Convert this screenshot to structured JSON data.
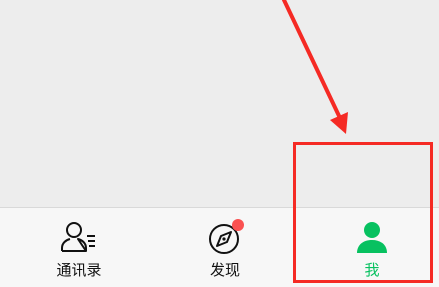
{
  "tabbar": {
    "tabs": [
      {
        "label": "通讯录",
        "icon": "contacts-icon",
        "active": false
      },
      {
        "label": "发现",
        "icon": "discover-compass-icon",
        "active": false,
        "badge": "red-dot"
      },
      {
        "label": "我",
        "icon": "me-person-icon",
        "active": true
      }
    ]
  },
  "colors": {
    "active": "#07c160",
    "inactive_text": "#111111",
    "annotation": "#f52a24",
    "badge": "#fa5151",
    "background": "#ededed",
    "tabbar_background": "#f7f7f7"
  }
}
